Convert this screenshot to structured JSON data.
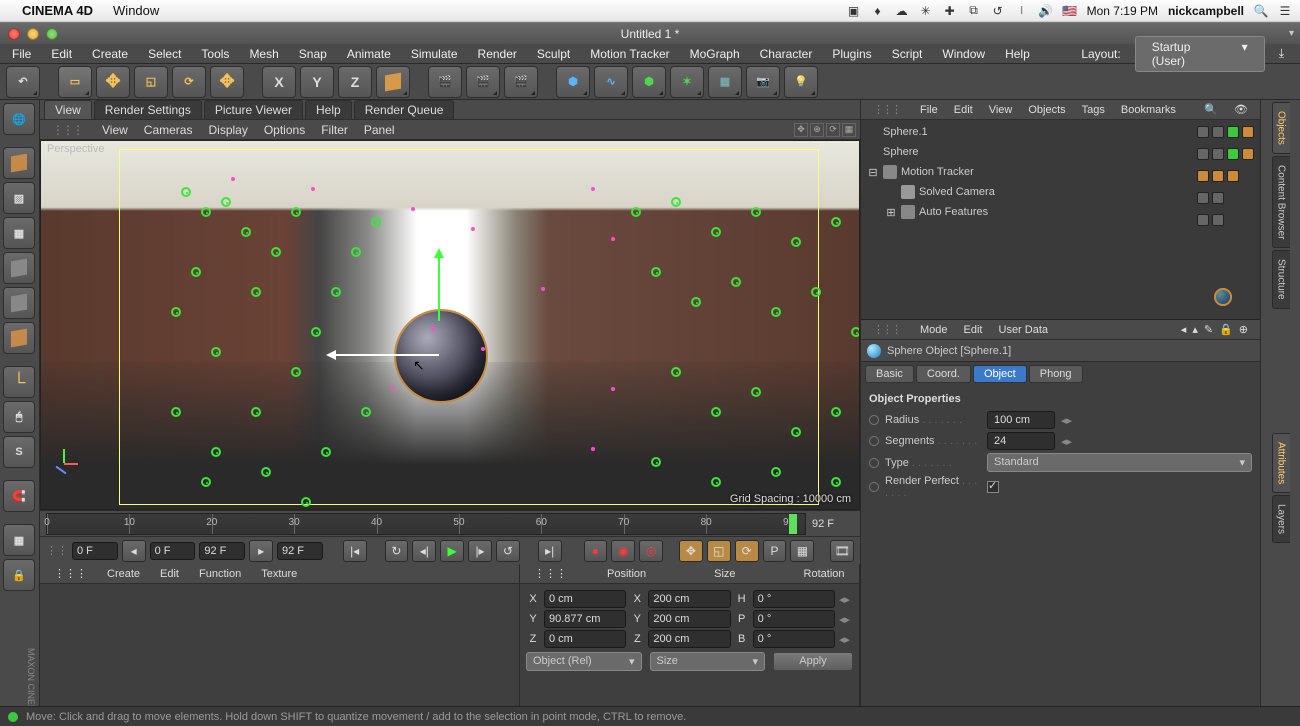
{
  "mac": {
    "app": "CINEMA 4D",
    "menu": "Window",
    "clock": "Mon 7:19 PM",
    "user": "nickcampbell"
  },
  "window": {
    "title": "Untitled 1 *"
  },
  "mainmenu": [
    "File",
    "Edit",
    "Create",
    "Select",
    "Tools",
    "Mesh",
    "Snap",
    "Animate",
    "Simulate",
    "Render",
    "Sculpt",
    "Motion Tracker",
    "MoGraph",
    "Character",
    "Plugins",
    "Script",
    "Window",
    "Help"
  ],
  "layout": {
    "label": "Layout:",
    "value": "Startup (User)"
  },
  "viewtabs": {
    "items": [
      "View",
      "Render Settings",
      "Picture Viewer",
      "Help",
      "Render Queue"
    ],
    "active": 0
  },
  "viewmenu": [
    "View",
    "Cameras",
    "Display",
    "Options",
    "Filter",
    "Panel"
  ],
  "viewport": {
    "label": "Perspective",
    "gridspacing": "Grid Spacing : 10000 cm"
  },
  "timeline": {
    "ticks": [
      0,
      10,
      20,
      30,
      40,
      50,
      60,
      70,
      80,
      90
    ],
    "end": "92 F"
  },
  "transport": {
    "start": "0 F",
    "from": "0 F",
    "to": "92 F",
    "current": "92 F"
  },
  "matmenu": [
    "Create",
    "Edit",
    "Function",
    "Texture"
  ],
  "coords": {
    "headers": {
      "pos": "Position",
      "size": "Size",
      "rot": "Rotation"
    },
    "rows": [
      {
        "ax": "X",
        "pos": "0 cm",
        "size": "200 cm",
        "rotax": "H",
        "rot": "0 °"
      },
      {
        "ax": "Y",
        "pos": "90.877 cm",
        "size": "200 cm",
        "rotax": "P",
        "rot": "0 °"
      },
      {
        "ax": "Z",
        "pos": "0 cm",
        "size": "200 cm",
        "rotax": "B",
        "rot": "0 °"
      }
    ],
    "modeA": "Object (Rel)",
    "modeB": "Size",
    "apply": "Apply"
  },
  "objmenu": [
    "File",
    "Edit",
    "View",
    "Objects",
    "Tags",
    "Bookmarks"
  ],
  "objects": [
    {
      "name": "Sphere.1",
      "icon": "sphere",
      "indent": 0,
      "expander": ""
    },
    {
      "name": "Sphere",
      "icon": "sphere",
      "indent": 0,
      "expander": ""
    },
    {
      "name": "Motion Tracker",
      "icon": "track",
      "indent": 0,
      "expander": "⊟"
    },
    {
      "name": "Solved Camera",
      "icon": "cam",
      "indent": 1,
      "expander": ""
    },
    {
      "name": "Auto Features",
      "icon": "track",
      "indent": 1,
      "expander": "⊞"
    }
  ],
  "attrmenu": [
    "Mode",
    "Edit",
    "User Data"
  ],
  "attr": {
    "title": "Sphere Object [Sphere.1]",
    "tabs": [
      "Basic",
      "Coord.",
      "Object",
      "Phong"
    ],
    "activeTab": 2,
    "section": "Object Properties",
    "props": {
      "radius_label": "Radius",
      "radius": "100 cm",
      "segments_label": "Segments",
      "segments": "24",
      "type_label": "Type",
      "type": "Standard",
      "renderperfect_label": "Render Perfect",
      "renderperfect": true
    }
  },
  "righttabs": [
    "Objects",
    "Content Browser",
    "Structure",
    "Attributes",
    "Layers"
  ],
  "status": "Move: Click and drag to move elements. Hold down SHIFT to quantize movement / add to the selection in point mode, CTRL to remove."
}
